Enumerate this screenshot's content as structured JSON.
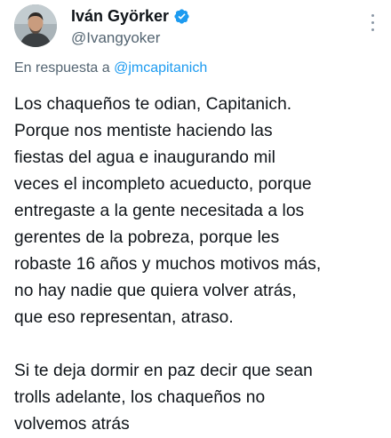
{
  "author": {
    "display_name": "Iván Györker",
    "handle": "@Ivangyoker",
    "verified": true
  },
  "reply": {
    "prefix": "En respuesta a",
    "mention": "@jmcapitanich"
  },
  "tweet": {
    "paragraphs": [
      "Los chaqueños te odian, Capitanich.\nPorque nos mentiste haciendo las\nfiestas del agua e inaugurando mil\nveces el incompleto acueducto, porque\nentregaste a la gente necesitada a los\ngerentes de la pobreza, porque les\nrobaste 16 años y muchos motivos más,\nno hay nadie que quiera volver atrás,\nque eso representan, atraso.",
      "Si te deja dormir en paz decir que sean\ntrolls adelante, los chaqueños no\nvolvemos atrás"
    ]
  },
  "icons": {
    "verified": "verified-badge-icon",
    "more": "more-options-icon"
  },
  "colors": {
    "verified_badge": "#1d9bf0",
    "mention": "#1d9bf0",
    "secondary_text": "#536471",
    "primary_text": "#0f1419"
  }
}
